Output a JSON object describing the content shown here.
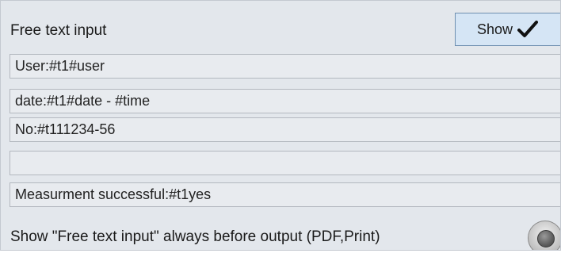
{
  "header": {
    "title": "Free text input",
    "show_button_label": "Show",
    "show_button_icon": "checkmark-icon"
  },
  "fields": [
    {
      "value": "User:#t1#user"
    },
    {
      "value": "date:#t1#date - #time"
    },
    {
      "value": "No:#t111234-56"
    },
    {
      "value": ""
    },
    {
      "value": "Measurment successful:#t1yes"
    }
  ],
  "option": {
    "label": "Show \"Free text input\" always before output (PDF,Print)",
    "toggle_icon": "radio-toggle-icon"
  }
}
